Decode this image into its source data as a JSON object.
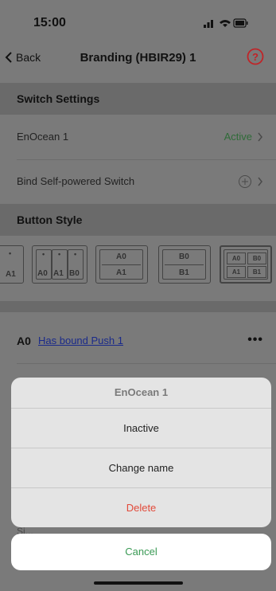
{
  "status_bar": {
    "time": "15:00"
  },
  "nav": {
    "back_label": "Back",
    "title": "Branding (HBIR29) 1"
  },
  "switch_settings": {
    "header": "Switch Settings",
    "enocean_label": "EnOcean 1",
    "enocean_status": "Active",
    "bind_label": "Bind Self-powered Switch"
  },
  "button_style": {
    "header": "Button Style",
    "tiles": [
      {
        "labels": [
          "A1"
        ]
      },
      {
        "labels": [
          "A0",
          "A1",
          "B0"
        ]
      },
      {
        "labels": [
          "A0",
          "A1"
        ]
      },
      {
        "labels": [
          "B0",
          "B1"
        ]
      },
      {
        "labels": [
          "A0",
          "B0",
          "A1",
          "B1"
        ]
      }
    ]
  },
  "a0_row": {
    "label": "A0",
    "link": "Has bound Push 1",
    "more": "•••"
  },
  "action_sheet": {
    "title": "EnOcean 1",
    "items": [
      "Inactive",
      "Change name",
      "Delete"
    ],
    "cancel": "Cancel"
  },
  "colors": {
    "active": "#3a8a45",
    "delete": "#e24a3a",
    "cancel": "#3a9a55",
    "help": "#d8262a",
    "link": "#1a2a8a"
  }
}
